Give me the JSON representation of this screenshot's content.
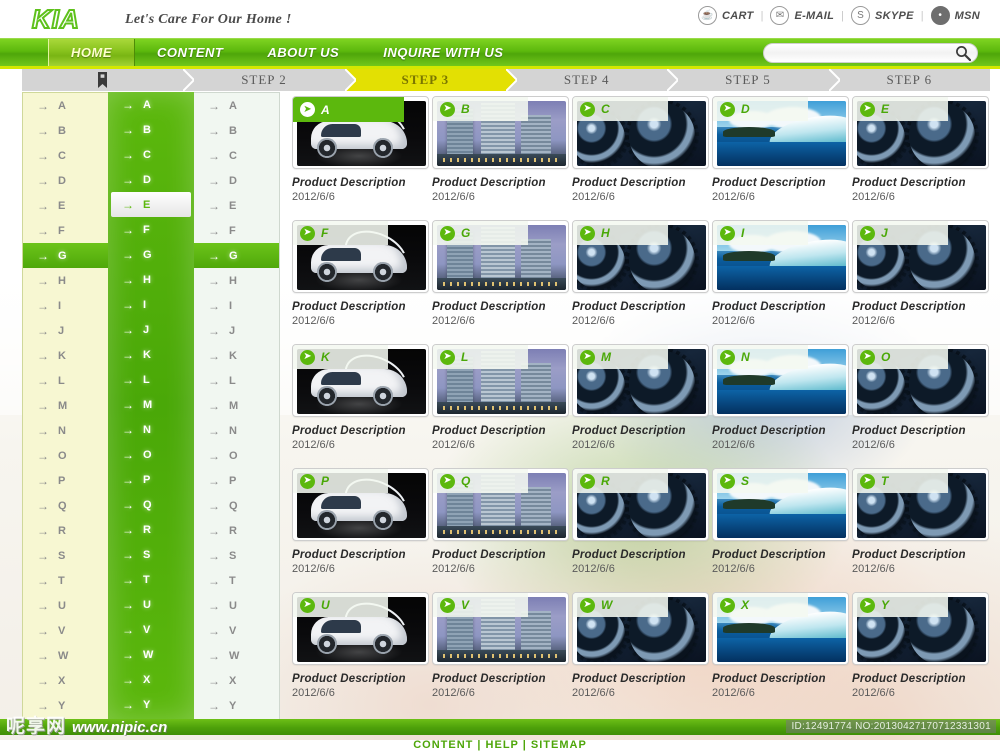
{
  "header": {
    "logo": "KIA",
    "tagline": "Let's Care For Our Home !",
    "links": [
      {
        "label": "CART",
        "icon": "cart-icon",
        "glyph": "☕"
      },
      {
        "label": "E-MAIL",
        "icon": "email-icon",
        "glyph": "✉"
      },
      {
        "label": "SKYPE",
        "icon": "skype-icon",
        "glyph": "S"
      },
      {
        "label": "MSN",
        "icon": "msn-icon",
        "glyph": "•"
      }
    ],
    "separator": "|"
  },
  "nav": {
    "items": [
      {
        "label": "HOME",
        "active": true
      },
      {
        "label": "CONTENT",
        "active": false
      },
      {
        "label": "ABOUT US",
        "active": false
      },
      {
        "label": "INQUIRE WITH US",
        "active": false
      }
    ]
  },
  "search": {
    "value": "",
    "placeholder": "",
    "icon": "search-icon"
  },
  "steps": [
    {
      "label": "",
      "icon": "bookmark-icon",
      "active": false
    },
    {
      "label": "STEP 2",
      "active": false
    },
    {
      "label": "STEP 3",
      "active": true
    },
    {
      "label": "STEP 4",
      "active": false
    },
    {
      "label": "STEP 5",
      "active": false
    },
    {
      "label": "STEP 6",
      "active": false
    }
  ],
  "sidebar": {
    "columns": [
      {
        "name": "column-cream",
        "selected": "G",
        "items": [
          "A",
          "B",
          "C",
          "D",
          "E",
          "F",
          "G",
          "H",
          "I",
          "J",
          "K",
          "L",
          "M",
          "N",
          "O",
          "P",
          "Q",
          "R",
          "S",
          "T",
          "U",
          "V",
          "W",
          "X",
          "Y"
        ]
      },
      {
        "name": "column-green",
        "selected": "E",
        "items": [
          "A",
          "B",
          "C",
          "D",
          "E",
          "F",
          "G",
          "H",
          "I",
          "J",
          "K",
          "L",
          "M",
          "N",
          "O",
          "P",
          "Q",
          "R",
          "S",
          "T",
          "U",
          "V",
          "W",
          "X",
          "Y"
        ]
      },
      {
        "name": "column-white",
        "selected": "G",
        "items": [
          "A",
          "B",
          "C",
          "D",
          "E",
          "F",
          "G",
          "H",
          "I",
          "J",
          "K",
          "L",
          "M",
          "N",
          "O",
          "P",
          "Q",
          "R",
          "S",
          "T",
          "U",
          "V",
          "W",
          "X",
          "Y"
        ]
      }
    ],
    "arrow_glyph": "→"
  },
  "grid": {
    "title_default": "Product Description",
    "date_default": "2012/6/6",
    "arrow_glyph": "➤",
    "cards": [
      {
        "letter": "A",
        "photo": "car",
        "title": "Product Description",
        "date": "2012/6/6",
        "highlight": true
      },
      {
        "letter": "B",
        "photo": "bldg",
        "title": "Product Description",
        "date": "2012/6/6",
        "highlight": false
      },
      {
        "letter": "C",
        "photo": "gear",
        "title": "Product Description",
        "date": "2012/6/6",
        "highlight": false
      },
      {
        "letter": "D",
        "photo": "wave",
        "title": "Product Description",
        "date": "2012/6/6",
        "highlight": false
      },
      {
        "letter": "E",
        "photo": "gear",
        "title": "Product Description",
        "date": "2012/6/6",
        "highlight": false
      },
      {
        "letter": "F",
        "photo": "car",
        "title": "Product Description",
        "date": "2012/6/6",
        "highlight": false
      },
      {
        "letter": "G",
        "photo": "bldg",
        "title": "Product Description",
        "date": "2012/6/6",
        "highlight": false
      },
      {
        "letter": "H",
        "photo": "gear",
        "title": "Product Description",
        "date": "2012/6/6",
        "highlight": false
      },
      {
        "letter": "I",
        "photo": "wave",
        "title": "Product Description",
        "date": "2012/6/6",
        "highlight": false
      },
      {
        "letter": "J",
        "photo": "gear",
        "title": "Product Description",
        "date": "2012/6/6",
        "highlight": false
      },
      {
        "letter": "K",
        "photo": "car",
        "title": "Product Description",
        "date": "2012/6/6",
        "highlight": false
      },
      {
        "letter": "L",
        "photo": "bldg",
        "title": "Product Description",
        "date": "2012/6/6",
        "highlight": false
      },
      {
        "letter": "M",
        "photo": "gear",
        "title": "Product Description",
        "date": "2012/6/6",
        "highlight": false
      },
      {
        "letter": "N",
        "photo": "wave",
        "title": "Product Description",
        "date": "2012/6/6",
        "highlight": false
      },
      {
        "letter": "O",
        "photo": "gear",
        "title": "Product Description",
        "date": "2012/6/6",
        "highlight": false
      },
      {
        "letter": "P",
        "photo": "car",
        "title": "Product Description",
        "date": "2012/6/6",
        "highlight": false
      },
      {
        "letter": "Q",
        "photo": "bldg",
        "title": "Product Description",
        "date": "2012/6/6",
        "highlight": false
      },
      {
        "letter": "R",
        "photo": "gear",
        "title": "Product Description",
        "date": "2012/6/6",
        "highlight": false
      },
      {
        "letter": "S",
        "photo": "wave",
        "title": "Product Description",
        "date": "2012/6/6",
        "highlight": false
      },
      {
        "letter": "T",
        "photo": "gear",
        "title": "Product Description",
        "date": "2012/6/6",
        "highlight": false
      },
      {
        "letter": "U",
        "photo": "car",
        "title": "Product Description",
        "date": "2012/6/6",
        "highlight": false
      },
      {
        "letter": "V",
        "photo": "bldg",
        "title": "Product Description",
        "date": "2012/6/6",
        "highlight": false
      },
      {
        "letter": "W",
        "photo": "gear",
        "title": "Product Description",
        "date": "2012/6/6",
        "highlight": false
      },
      {
        "letter": "X",
        "photo": "wave",
        "title": "Product Description",
        "date": "2012/6/6",
        "highlight": false
      },
      {
        "letter": "Y",
        "photo": "gear",
        "title": "Product Description",
        "date": "2012/6/6",
        "highlight": false
      }
    ]
  },
  "footer": {
    "watermark_logo": "呢享网",
    "watermark_url": "www.nipic.cn",
    "watermark_id": "ID:12491774 NO:20130427170712331301",
    "links": "CONTENT | HELP | SITEMAP"
  },
  "colors": {
    "brand_green": "#5cb80d",
    "nav_green": "#4ea60a",
    "active_step_yellow": "#e3e003",
    "underline_yellow": "#d4e800",
    "cream": "#f7f7d2",
    "step_gray": "#d4d4d4"
  }
}
